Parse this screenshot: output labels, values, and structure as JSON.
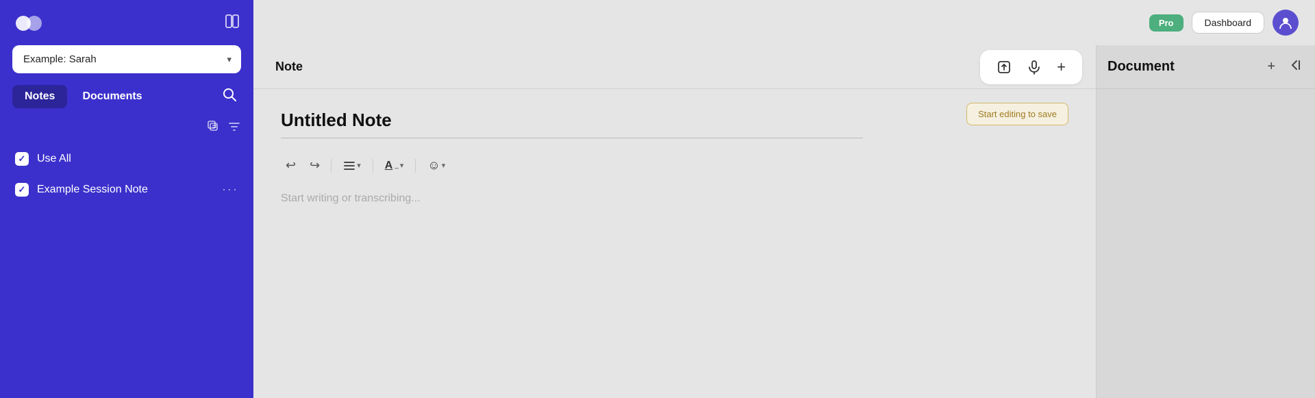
{
  "sidebar": {
    "logo_alt": "App Logo",
    "select_value": "Example: Sarah",
    "select_placeholder": "Example: Sarah",
    "tabs": [
      {
        "id": "notes",
        "label": "Notes",
        "active": true
      },
      {
        "id": "documents",
        "label": "Documents",
        "active": false
      }
    ],
    "search_icon": "🔍",
    "tool_icons": [
      "copy-icon",
      "filter-icon"
    ],
    "items": [
      {
        "id": "use-all",
        "label": "Use All",
        "checked": true
      },
      {
        "id": "example-session-note",
        "label": "Example Session Note",
        "checked": true
      }
    ]
  },
  "topbar": {
    "pro_label": "Pro",
    "dashboard_label": "Dashboard",
    "avatar_initial": "👤"
  },
  "note_header": {
    "title": "Note",
    "upload_icon": "upload",
    "mic_icon": "mic",
    "add_icon": "+"
  },
  "note_editor": {
    "title_value": "Untitled Note",
    "title_placeholder": "Untitled Note",
    "save_hint": "Start editing to save",
    "placeholder": "Start writing or transcribing..."
  },
  "toolbar": {
    "undo_icon": "↩",
    "redo_icon": "↪",
    "align_icon": "≡",
    "text_format_icon": "A",
    "emoji_icon": "☺"
  },
  "document_panel": {
    "title": "Document",
    "add_icon": "+",
    "collapse_icon": "⊳"
  }
}
